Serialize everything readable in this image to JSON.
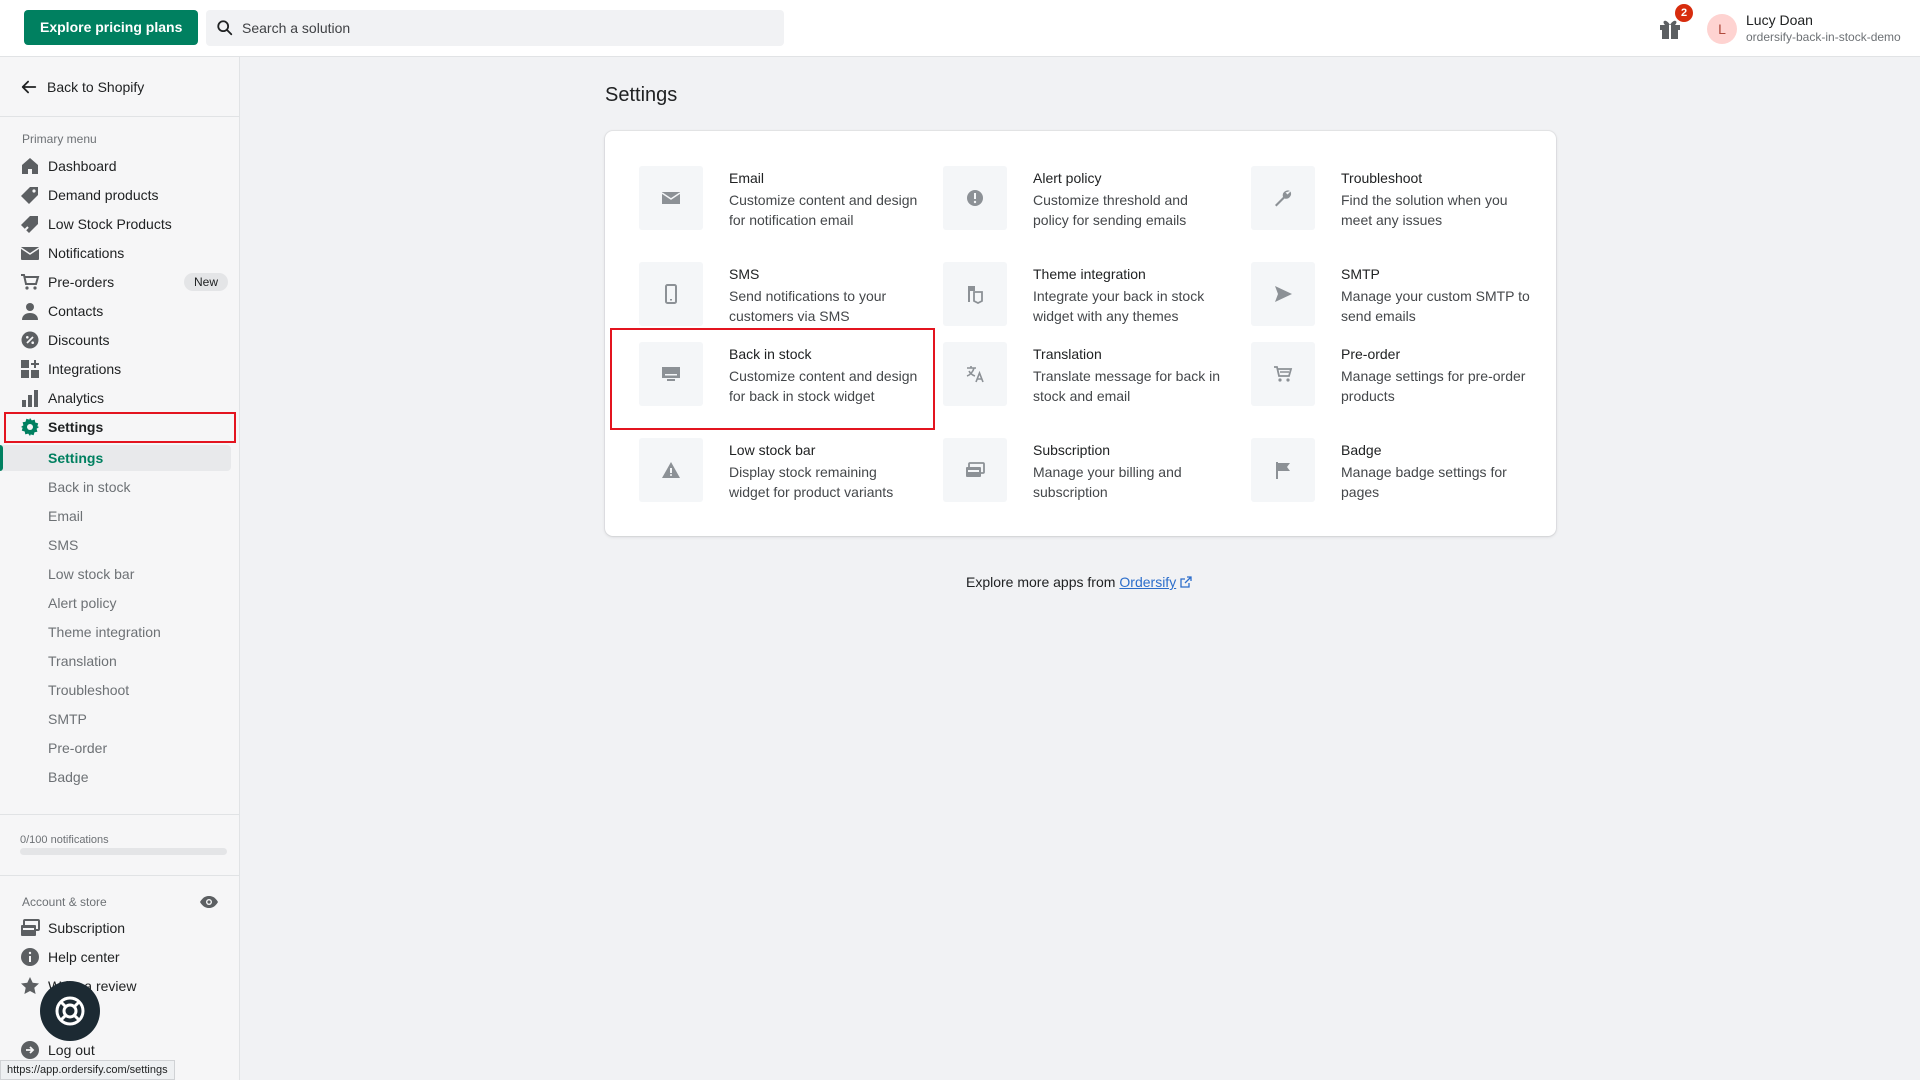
{
  "topbar": {
    "explore_button": "Explore pricing plans",
    "search_placeholder": "Search a solution",
    "gift_badge_count": "2",
    "user_initial": "L",
    "user_name": "Lucy Doan",
    "user_store": "ordersify-back-in-stock-demo"
  },
  "sidebar": {
    "back_label": "Back to Shopify",
    "primary_menu_title": "Primary menu",
    "items": [
      {
        "label": "Dashboard",
        "icon": "home-icon"
      },
      {
        "label": "Demand products",
        "icon": "tag-icon"
      },
      {
        "label": "Low Stock Products",
        "icon": "tag-arrow-icon"
      },
      {
        "label": "Notifications",
        "icon": "mail-icon"
      },
      {
        "label": "Pre-orders",
        "icon": "cart-icon",
        "badge": "New"
      },
      {
        "label": "Contacts",
        "icon": "person-icon"
      },
      {
        "label": "Discounts",
        "icon": "discount-icon"
      },
      {
        "label": "Integrations",
        "icon": "apps-icon"
      },
      {
        "label": "Analytics",
        "icon": "bar-chart-icon"
      },
      {
        "label": "Settings",
        "icon": "gear-icon"
      }
    ],
    "sub_items": [
      "Settings",
      "Back in stock",
      "Email",
      "SMS",
      "Low stock bar",
      "Alert policy",
      "Theme integration",
      "Translation",
      "Troubleshoot",
      "SMTP",
      "Pre-order",
      "Badge"
    ],
    "notifications_usage": "0/100 notifications",
    "notifications_fraction": 0,
    "account_title": "Account & store",
    "account_items": [
      {
        "label": "Subscription",
        "icon": "billing-icon"
      },
      {
        "label": "Help center",
        "icon": "info-icon"
      },
      {
        "label": "Write a review",
        "icon": "star-icon"
      },
      {
        "label": "Log out",
        "icon": "logout-icon"
      }
    ],
    "status_url": "https://app.ordersify.com/settings"
  },
  "main": {
    "title": "Settings",
    "settings": [
      {
        "title": "Email",
        "desc": "Customize content and design for notification email",
        "icon": "email-icon"
      },
      {
        "title": "Alert policy",
        "desc": "Customize threshold and policy for sending emails",
        "icon": "alert-circle-icon"
      },
      {
        "title": "Troubleshoot",
        "desc": "Find the solution when you meet any issues",
        "icon": "wrench-icon"
      },
      {
        "title": "SMS",
        "desc": "Send notifications to your customers via SMS",
        "icon": "mobile-icon"
      },
      {
        "title": "Theme integration",
        "desc": "Integrate your back in stock widget with any themes",
        "icon": "theme-icon"
      },
      {
        "title": "SMTP",
        "desc": "Manage your custom SMTP to send emails",
        "icon": "send-icon"
      },
      {
        "title": "Back in stock",
        "desc": "Customize content and design for back in stock widget",
        "icon": "desktop-icon"
      },
      {
        "title": "Translation",
        "desc": "Translate message for back in stock and email",
        "icon": "translate-icon"
      },
      {
        "title": "Pre-order",
        "desc": "Manage settings for pre-order products",
        "icon": "cart-icon"
      },
      {
        "title": "Low stock bar",
        "desc": "Display stock remaining widget for product variants",
        "icon": "warning-icon"
      },
      {
        "title": "Subscription",
        "desc": "Manage your billing and subscription",
        "icon": "billing-icon"
      },
      {
        "title": "Badge",
        "desc": "Manage badge settings for pages",
        "icon": "flag-icon"
      }
    ],
    "explore_prefix": "Explore more apps from",
    "explore_link": "Ordersify"
  },
  "colors": {
    "brand": "#008060",
    "highlight": "#e3141f",
    "badge": "#d72c0d"
  }
}
